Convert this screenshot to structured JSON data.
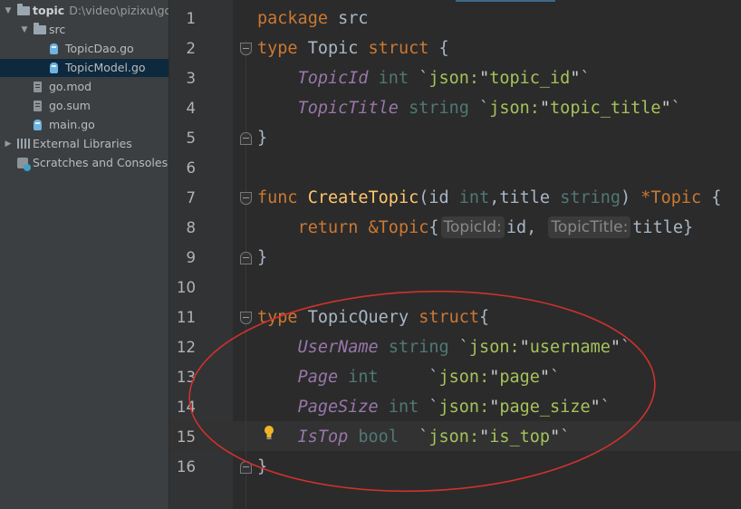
{
  "sidebar": {
    "items": [
      {
        "label": "topic",
        "path": "D:\\video\\pizixu\\go-",
        "icon": "folder-icon",
        "arrow": "▼",
        "indent": 0,
        "bold": true
      },
      {
        "label": "src",
        "icon": "folder-icon",
        "arrow": "▼",
        "indent": 1
      },
      {
        "label": "TopicDao.go",
        "icon": "go-file-icon",
        "indent": 2
      },
      {
        "label": "TopicModel.go",
        "icon": "go-file-icon",
        "indent": 2,
        "selected": true
      },
      {
        "label": "go.mod",
        "icon": "file-icon",
        "indent": 1
      },
      {
        "label": "go.sum",
        "icon": "file-icon",
        "indent": 1
      },
      {
        "label": "main.go",
        "icon": "go-file-icon",
        "indent": 1
      },
      {
        "label": "External Libraries",
        "icon": "library-icon",
        "arrow": "▶",
        "indent": 0
      },
      {
        "label": "Scratches and Consoles",
        "icon": "scratches-icon",
        "indent": 0
      }
    ]
  },
  "editor": {
    "line_numbers": [
      "1",
      "2",
      "3",
      "4",
      "5",
      "6",
      "7",
      "8",
      "9",
      "10",
      "11",
      "12",
      "13",
      "14",
      "15",
      "16"
    ],
    "highlighted_line": 15,
    "lines": [
      [
        [
          "kw",
          "package"
        ],
        [
          "tn",
          " src"
        ]
      ],
      [
        [
          "kw",
          "type"
        ],
        [
          "tn",
          " Topic "
        ],
        [
          "ty",
          "struct"
        ],
        [
          "tn",
          " {"
        ]
      ],
      [
        [
          "tn",
          "    "
        ],
        [
          "field",
          "TopicId"
        ],
        [
          "tn",
          " "
        ],
        [
          "ptype",
          "int"
        ],
        [
          "tn",
          " `"
        ],
        [
          "str",
          "json:"
        ],
        [
          "strq",
          "\""
        ],
        [
          "str",
          "topic_id"
        ],
        [
          "strq",
          "\""
        ],
        [
          "tn",
          "`"
        ]
      ],
      [
        [
          "tn",
          "    "
        ],
        [
          "field",
          "TopicTitle"
        ],
        [
          "tn",
          " "
        ],
        [
          "ptype",
          "string"
        ],
        [
          "tn",
          " `"
        ],
        [
          "str",
          "json:"
        ],
        [
          "strq",
          "\""
        ],
        [
          "str",
          "topic_title"
        ],
        [
          "strq",
          "\""
        ],
        [
          "tn",
          "`"
        ]
      ],
      [
        [
          "tn",
          "}"
        ]
      ],
      [],
      [
        [
          "kw",
          "func"
        ],
        [
          "tn",
          " "
        ],
        [
          "fn",
          "CreateTopic"
        ],
        [
          "tn",
          "(id "
        ],
        [
          "ptype",
          "int"
        ],
        [
          "tn",
          ",title "
        ],
        [
          "ptype",
          "string"
        ],
        [
          "tn",
          ") "
        ],
        [
          "op",
          "*"
        ],
        [
          "ty",
          "Topic"
        ],
        [
          "tn",
          " {"
        ]
      ],
      [
        [
          "tn",
          "    "
        ],
        [
          "kw",
          "return"
        ],
        [
          "tn",
          " "
        ],
        [
          "op",
          "&"
        ],
        [
          "ty",
          "Topic"
        ],
        [
          "tn",
          "{"
        ],
        [
          "hint",
          "TopicId:"
        ],
        [
          "tn",
          "id, "
        ],
        [
          "hint",
          "TopicTitle:"
        ],
        [
          "tn",
          "title}"
        ]
      ],
      [
        [
          "tn",
          "}"
        ]
      ],
      [],
      [
        [
          "kw",
          "type"
        ],
        [
          "tn",
          " TopicQuery "
        ],
        [
          "ty",
          "struct"
        ],
        [
          "tn",
          "{"
        ]
      ],
      [
        [
          "tn",
          "    "
        ],
        [
          "field",
          "UserName"
        ],
        [
          "tn",
          " "
        ],
        [
          "ptype",
          "string"
        ],
        [
          "tn",
          " `"
        ],
        [
          "str",
          "json:"
        ],
        [
          "strq",
          "\""
        ],
        [
          "str",
          "username"
        ],
        [
          "strq",
          "\""
        ],
        [
          "tn",
          "`"
        ]
      ],
      [
        [
          "tn",
          "    "
        ],
        [
          "field",
          "Page"
        ],
        [
          "tn",
          " "
        ],
        [
          "ptype",
          "int"
        ],
        [
          "tn",
          "     `"
        ],
        [
          "str",
          "json:"
        ],
        [
          "strq",
          "\""
        ],
        [
          "str",
          "page"
        ],
        [
          "strq",
          "\""
        ],
        [
          "tn",
          "`"
        ]
      ],
      [
        [
          "tn",
          "    "
        ],
        [
          "field",
          "PageSize"
        ],
        [
          "tn",
          " "
        ],
        [
          "ptype",
          "int"
        ],
        [
          "tn",
          " `"
        ],
        [
          "str",
          "json:"
        ],
        [
          "strq",
          "\""
        ],
        [
          "str",
          "page_size"
        ],
        [
          "strq",
          "\""
        ],
        [
          "tn",
          "`"
        ]
      ],
      [
        [
          "tn",
          "    "
        ],
        [
          "field",
          "IsTop"
        ],
        [
          "tn",
          " "
        ],
        [
          "ptype",
          "bool"
        ],
        [
          "tn",
          "  `"
        ],
        [
          "str",
          "json:"
        ],
        [
          "strq",
          "\""
        ],
        [
          "str",
          "is_top"
        ],
        [
          "strq",
          "\""
        ],
        [
          "tn",
          "`"
        ]
      ],
      [
        [
          "tn",
          "}"
        ]
      ]
    ],
    "intention_icon": "lightbulb-icon"
  },
  "colors": {
    "annotation_ellipse": "#d0312d",
    "keyword": "#cc7832",
    "field": "#9876aa",
    "string": "#a5c25c",
    "function": "#ffc66d"
  }
}
